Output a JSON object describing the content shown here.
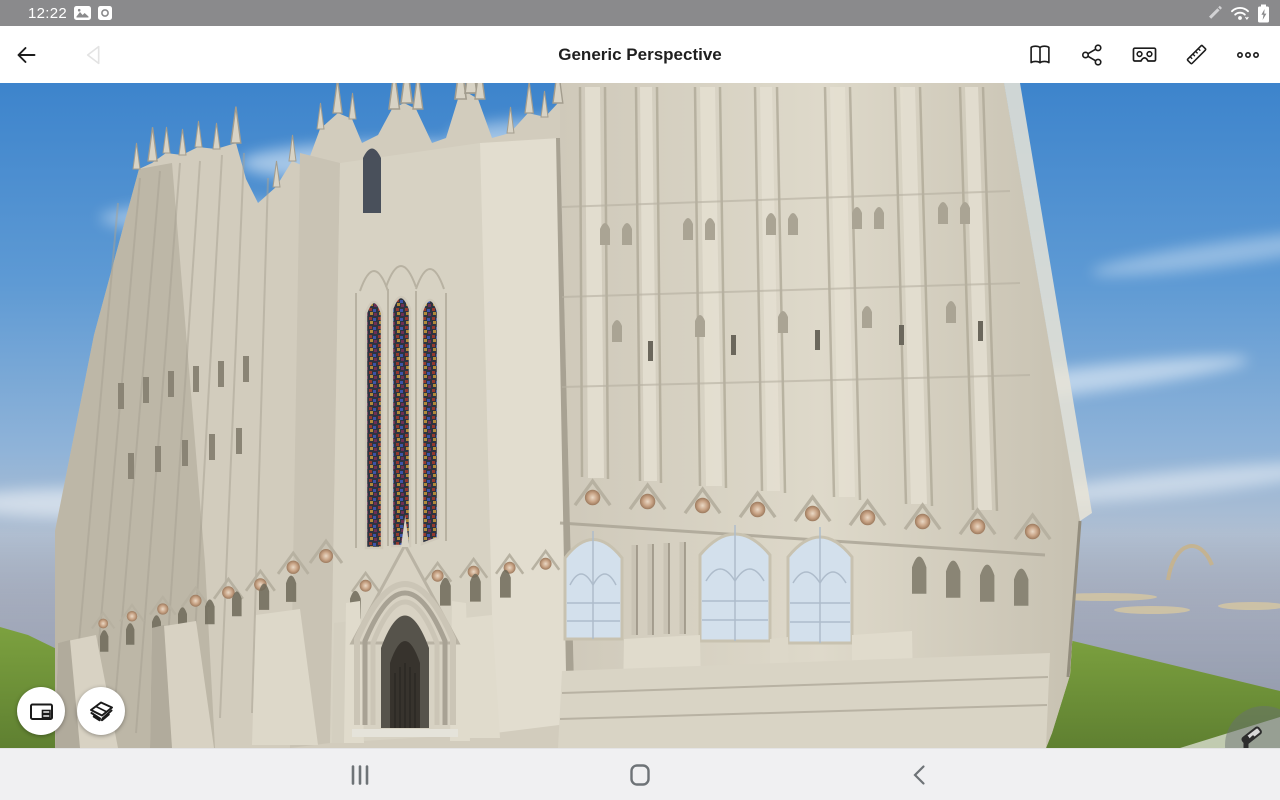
{
  "status_bar": {
    "time": "12:22",
    "bg_color": "#8a8a8c",
    "left_icons": [
      "image-notification-icon",
      "screen-record-notification-icon"
    ],
    "right_icons": [
      "stylus-icon",
      "wifi-icon",
      "battery-charging-icon"
    ]
  },
  "toolbar": {
    "title": "Generic Perspective",
    "left_icons": [
      "back-arrow-icon",
      "previous-view-icon"
    ],
    "right_icons": [
      "views-book-icon",
      "share-icon",
      "vr-cardboard-icon",
      "measure-ruler-icon",
      "more-options-icon"
    ]
  },
  "scene": {
    "label": "3D model viewport showing a Gothic cathedral west front in perspective",
    "colors": {
      "sky_top": "#3d84cc",
      "sky_mid": "#8fb3d8",
      "horizon_fog": "#9aa2b4",
      "grass": "#74993c",
      "stone_light": "#e8e3d5",
      "stone_shadow": "#a59f90",
      "stained_glass": "#2e3340",
      "clear_glass": "#d3e0ec",
      "pavement": "#f1f2ef"
    }
  },
  "overlay_buttons": {
    "layouts": "sheet-layout-button",
    "model_views": "model-stack-button",
    "walk_mode": "walk-mode-button"
  },
  "nav_bar": {
    "bg_color": "#f0f0f2",
    "icons": [
      "recent-apps-icon",
      "home-icon",
      "back-icon"
    ]
  }
}
